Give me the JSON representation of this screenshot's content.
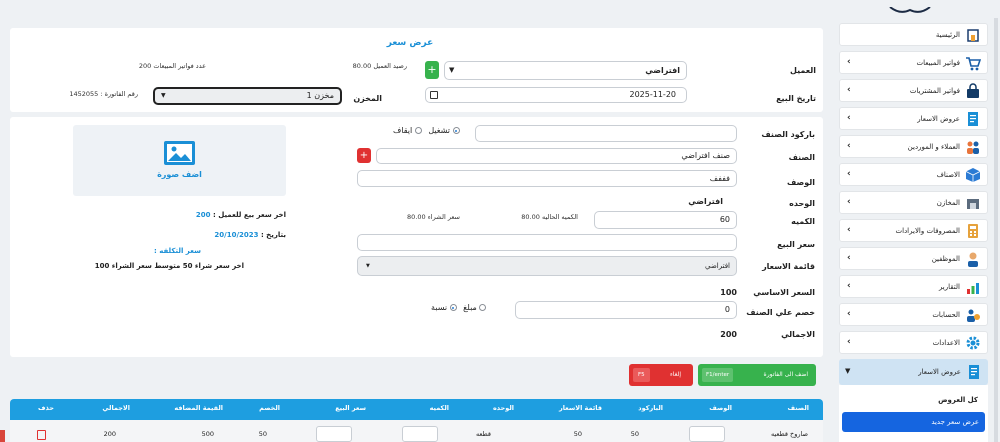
{
  "form": {
    "title": "عرض سعر",
    "customer_label": "العميل",
    "customer_value": "افتراضي",
    "customer_balance": "رصيد العميل 80.00",
    "sales_invoice_count": "عدد فواتير المبيعات 200",
    "sale_date_label": "تاريخ البيع",
    "sale_date_value": "2025-11-20",
    "warehouse_label": "المخزن",
    "warehouse_value": "مخزن 1",
    "invoice_number": "رقم الفاتورة : 1452055"
  },
  "item": {
    "barcode_label": "باركود الصنف",
    "run_label": "تشغيل",
    "stop_label": "ايقاف",
    "item_label": "الصنف",
    "item_value": "صنف افتراضي",
    "description_label": "الوصف",
    "description_value": "فففف",
    "unit_label": "الوحده",
    "unit_value": "افتراضي",
    "quantity_label": "الكميه",
    "quantity_value": "60",
    "current_qty": "الكميه الحاليه 80.00",
    "purchase_price": "سعر الشراء 80.00",
    "sale_price_label": "سعر البيع",
    "price_list_label": "قائمة الاسعار",
    "price_list_value": "افتراضي",
    "base_price_label": "السعر الاساسي",
    "base_price_value": "100",
    "discount_label": "خصم علي الصنف",
    "discount_value": "0",
    "amount_label": "مبلغ",
    "percent_label": "نسبة",
    "total_label": "الاجمالي",
    "total_value": "200"
  },
  "image": {
    "add_label": "اضف صورة"
  },
  "info": {
    "last_sale_label": "اخر سعر بيع للعميل :",
    "last_sale_value": "200",
    "date_label": "بتاريخ :",
    "date_value": "20/10/2023",
    "cost_label": "سعر التكلفه :",
    "cost_line": "اخر سعر شراء 50 متوسط سعر الشراء 100"
  },
  "buttons": {
    "add_to_invoice": "اضف الى الفاتورة",
    "add_key": "F1/enter",
    "cancel": "إلغاء",
    "cancel_key": "F5"
  },
  "table": {
    "headers": [
      "الصنف",
      "الوصف",
      "الباركود",
      "قائمة الاسعار",
      "الوحده",
      "الكميه",
      "سعر البيع",
      "الخصم",
      "القيمة المضافه",
      "الاجمالي",
      "حذف"
    ],
    "row": {
      "item": "صاروخ قطعيه",
      "barcode": "50",
      "price_list": "50",
      "unit": "قطعه",
      "discount": "50",
      "vat": "500",
      "total": "200"
    }
  },
  "sidebar": {
    "items": [
      {
        "label": "الرئيسية",
        "icon": "home-icon"
      },
      {
        "label": "فواتير المبيعات",
        "icon": "cart-icon"
      },
      {
        "label": "فواتير المشتريات",
        "icon": "bag-icon"
      },
      {
        "label": "عروض الاسعار",
        "icon": "document-icon"
      },
      {
        "label": "العملاء و الموردين",
        "icon": "people-icon"
      },
      {
        "label": "الاصناف",
        "icon": "box-icon"
      },
      {
        "label": "المخازن",
        "icon": "warehouse-icon"
      },
      {
        "label": "المصروفات والايرادات",
        "icon": "calculator-icon"
      },
      {
        "label": "الموظفين",
        "icon": "employee-icon"
      },
      {
        "label": "التقارير",
        "icon": "chart-icon"
      },
      {
        "label": "الحسابات",
        "icon": "accounts-icon"
      },
      {
        "label": "الاعدادات",
        "icon": "gear-icon"
      },
      {
        "label": "عروض الاسعار",
        "icon": "document-icon"
      }
    ],
    "sub_all": "كل العروض",
    "sub_new": "عرض سعر جديد"
  },
  "colors": {
    "accent": "#1a8fd6",
    "green": "#37b24d",
    "red": "#e03131",
    "table_header": "#1e9ee0"
  }
}
